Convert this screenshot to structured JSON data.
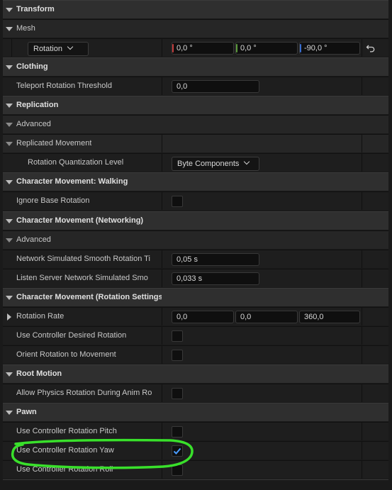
{
  "sections": {
    "transform": "Transform",
    "mesh": "Mesh",
    "clothing": "Clothing",
    "replication": "Replication",
    "char_walking": "Character Movement: Walking",
    "char_networking": "Character Movement (Networking)",
    "char_rotation": "Character Movement (Rotation Settings)",
    "root_motion": "Root Motion",
    "pawn": "Pawn"
  },
  "mesh": {
    "rotation_combo": "Rotation",
    "x": "0,0 °",
    "y": "0,0 °",
    "z": "-90,0 °"
  },
  "clothing": {
    "teleport_label": "Teleport Rotation Threshold",
    "teleport_value": "0,0"
  },
  "replication": {
    "advanced": "Advanced",
    "replicated_movement": "Replicated Movement",
    "quantization_label": "Rotation Quantization Level",
    "quantization_value": "Byte Components"
  },
  "walking": {
    "ignore_base_rotation": "Ignore Base Rotation",
    "ignore_base_rotation_checked": false
  },
  "networking": {
    "advanced": "Advanced",
    "smooth_label": "Network Simulated Smooth Rotation Ti",
    "smooth_value": "0,05 s",
    "listen_label": "Listen Server Network Simulated Smo",
    "listen_value": "0,033 s"
  },
  "rotation_settings": {
    "rotation_rate_label": "Rotation Rate",
    "rate_x": "0,0",
    "rate_y": "0,0",
    "rate_z": "360,0",
    "use_desired": "Use Controller Desired Rotation",
    "use_desired_checked": false,
    "orient": "Orient Rotation to Movement",
    "orient_checked": false
  },
  "root_motion": {
    "allow_physics": "Allow Physics Rotation During Anim Ro",
    "allow_physics_checked": false
  },
  "pawn": {
    "pitch": "Use Controller Rotation Pitch",
    "pitch_checked": false,
    "yaw": "Use Controller Rotation Yaw",
    "yaw_checked": true,
    "roll": "Use Controller Rotation Roll",
    "roll_checked": false
  },
  "colors": {
    "axis_x": "#c23a3a",
    "axis_y": "#5a9a3a",
    "axis_z": "#3a6ed0",
    "checkmark": "#4a9cff",
    "highlight_ring": "#39e02b"
  },
  "icons": {
    "reset": "reset-arrow-icon",
    "expand": "triangle-down-icon",
    "collapsed": "triangle-right-icon"
  }
}
